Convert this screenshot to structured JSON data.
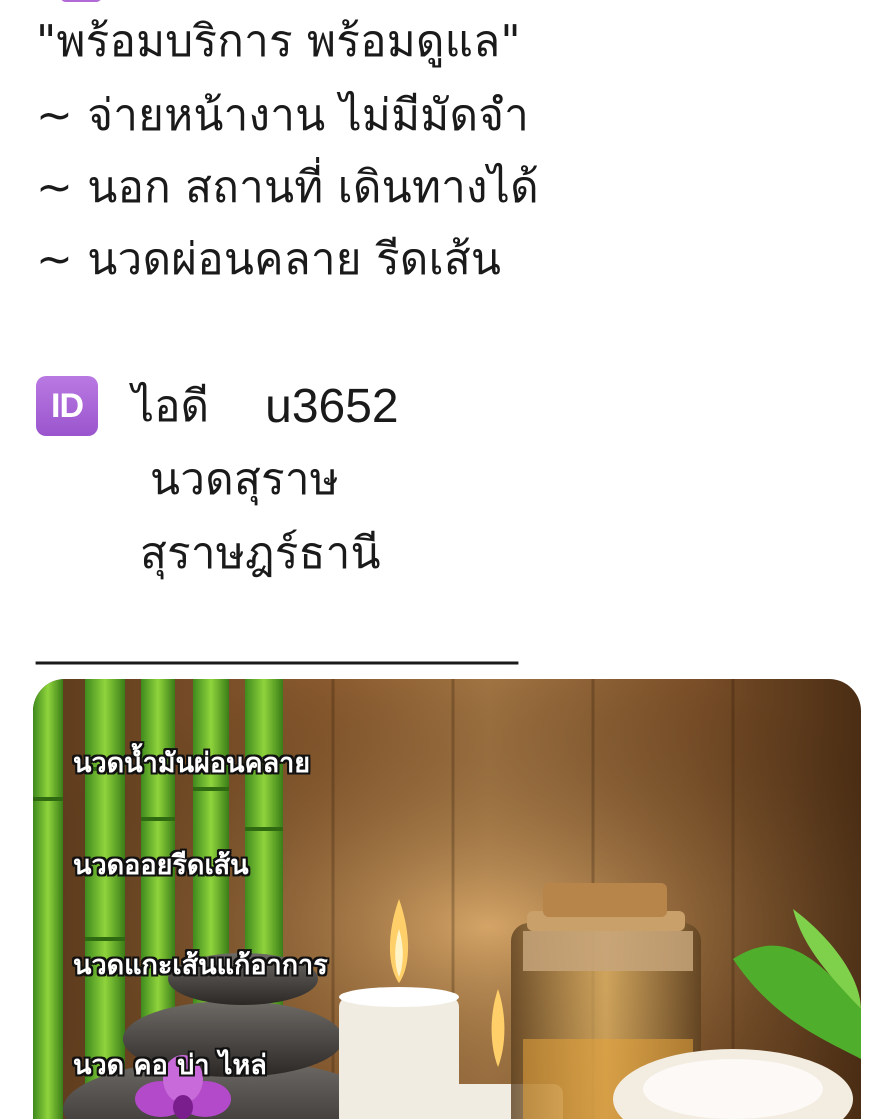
{
  "post": {
    "lines": [
      "\"พร้อมบริการ พร้อมดูแล\"",
      "~ จ่ายหน้างาน ไม่มีมัดจำ",
      "~ นอก สถานที่ เดินทางได้",
      "~ นวดผ่อนคลาย รีดเส้น"
    ],
    "id_emoji": "ID",
    "id_label": "ไอดี",
    "id_value": "u3652",
    "name": "นวดสุราษ",
    "province": "สุราษฎร์ธานี",
    "divider": "________________________"
  },
  "image": {
    "services": [
      "นวดน้ำมันผ่อนคลาย",
      "นวดออยรีดเส้น",
      "นวดแกะเส้นแก้อาการ",
      "นวด คอ บ่า ไหล่"
    ]
  }
}
